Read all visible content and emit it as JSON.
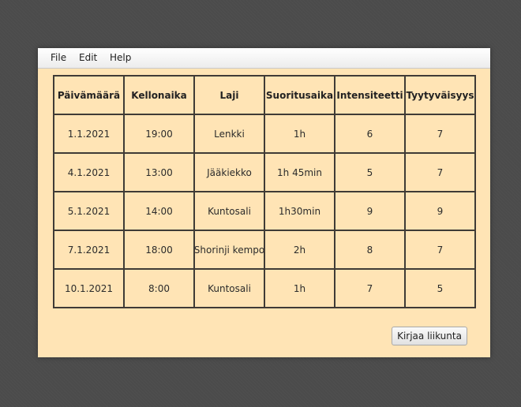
{
  "menu": {
    "file": "File",
    "edit": "Edit",
    "help": "Help"
  },
  "table": {
    "headers": [
      "Päivämäärä",
      "Kellonaika",
      "Laji",
      "Suoritusaika",
      "Intensiteetti",
      "Tyytyväisyys"
    ],
    "rows": [
      [
        "1.1.2021",
        "19:00",
        "Lenkki",
        "1h",
        "6",
        "7"
      ],
      [
        "4.1.2021",
        "13:00",
        "Jääkiekko",
        "1h 45min",
        "5",
        "7"
      ],
      [
        "5.1.2021",
        "14:00",
        "Kuntosali",
        "1h30min",
        "9",
        "9"
      ],
      [
        "7.1.2021",
        "18:00",
        "Shorinji kempo",
        "2h",
        "8",
        "7"
      ],
      [
        "10.1.2021",
        "8:00",
        "Kuntosali",
        "1h",
        "7",
        "5"
      ]
    ]
  },
  "actions": {
    "log_exercise": "Kirjaa liikunta"
  },
  "colors": {
    "window_background": "#ffe4b5",
    "grid_line": "#3f3b36",
    "desktop": "#4b4b4b"
  }
}
